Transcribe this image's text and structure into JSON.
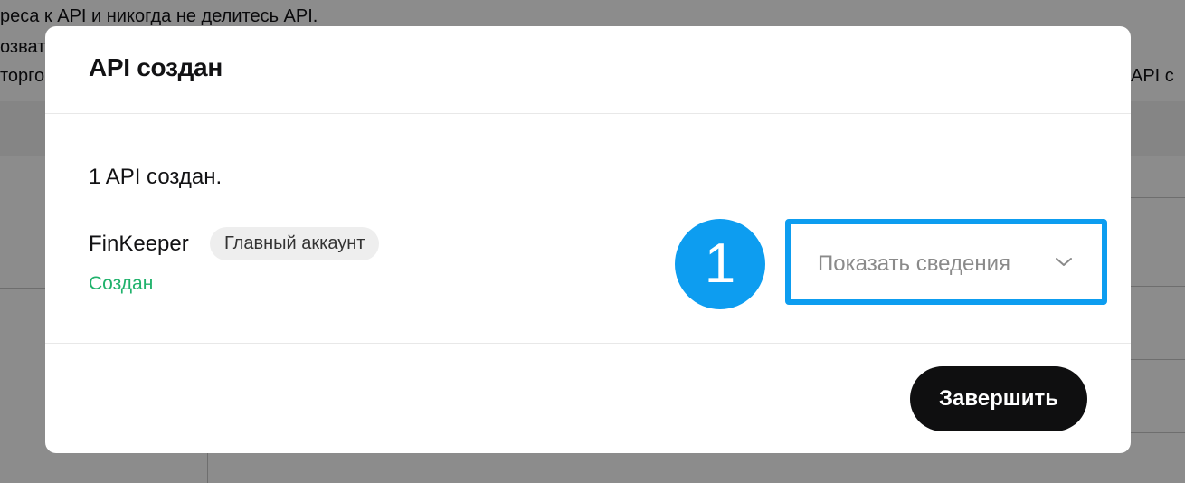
{
  "background": {
    "line1": "реса к API и никогда не делитесь API.",
    "line2": "озват",
    "line3": "торго",
    "right_text": "API с"
  },
  "modal": {
    "title": "API создан",
    "created_message": "1 API создан.",
    "api_name": "FinKeeper",
    "account_badge": "Главный аккаунт",
    "status": "Создан",
    "step_number": "1",
    "details_toggle_label": "Показать сведения",
    "details_toggle_icon": "chevron-down-icon",
    "finish_label": "Завершить"
  },
  "colors": {
    "accent_highlight": "#0d9df0",
    "status_success": "#20b26c",
    "primary_button": "#0f0f10"
  }
}
